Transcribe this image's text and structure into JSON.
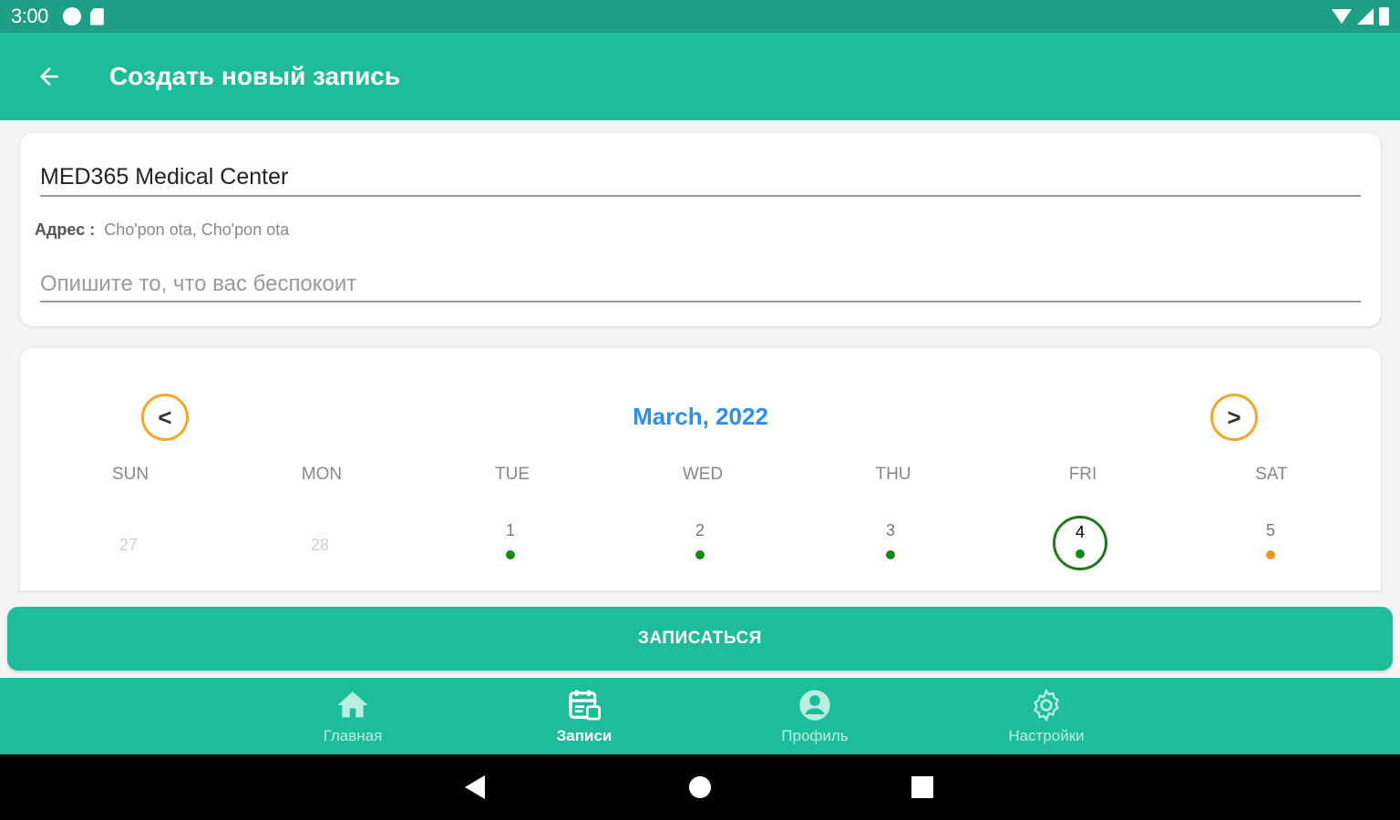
{
  "status_bar": {
    "time": "3:00"
  },
  "app_bar": {
    "title": "Создать новый запись"
  },
  "form": {
    "clinic_name": "MED365 Medical Center",
    "address_label": "Адрес :",
    "address_value": "Cho'pon ota, Cho'pon ota",
    "complaint_placeholder": "Опишите то, что вас беспокоит"
  },
  "calendar": {
    "month_title": "March, 2022",
    "prev_label": "<",
    "next_label": ">",
    "weekdays": [
      "SUN",
      "MON",
      "TUE",
      "WED",
      "THU",
      "FRI",
      "SAT"
    ],
    "days": [
      {
        "num": "27",
        "state": "past"
      },
      {
        "num": "28",
        "state": "past"
      },
      {
        "num": "1",
        "state": "available",
        "dot_color": "#138a13"
      },
      {
        "num": "2",
        "state": "available",
        "dot_color": "#138a13"
      },
      {
        "num": "3",
        "state": "available",
        "dot_color": "#138a13"
      },
      {
        "num": "4",
        "state": "selected",
        "dot_color": "#138a13"
      },
      {
        "num": "5",
        "state": "available",
        "dot_color": "#f5931f"
      }
    ]
  },
  "book_button": {
    "label": "ЗАПИСАТЬСЯ"
  },
  "bottom_nav": {
    "items": [
      {
        "label": "Главная",
        "icon": "home-icon"
      },
      {
        "label": "Записи",
        "icon": "appointments-icon",
        "current": true
      },
      {
        "label": "Профиль",
        "icon": "profile-icon"
      },
      {
        "label": "Настройки",
        "icon": "settings-icon"
      }
    ]
  },
  "colors": {
    "primary": "#1dbd9c",
    "status_bar": "#1e9f85",
    "accent_orange": "#f5a623",
    "month_blue": "#2a8ff0",
    "selected_green": "#1f7a1f"
  }
}
